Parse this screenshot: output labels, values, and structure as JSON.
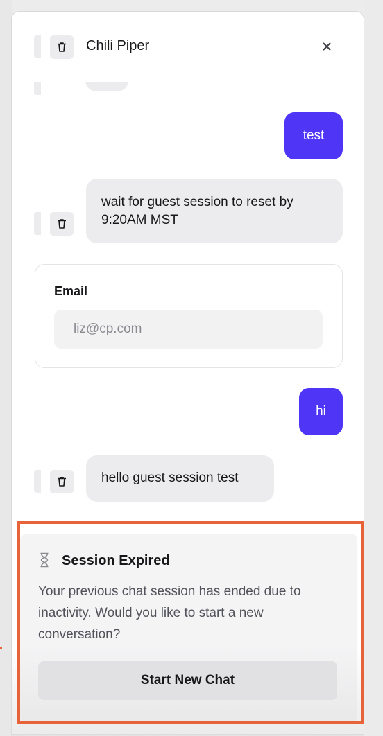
{
  "header": {
    "title": "Chili Piper",
    "close_label": "×"
  },
  "messages": [
    {
      "role": "user",
      "text": "test"
    },
    {
      "role": "bot",
      "text": "wait for guest session to reset by 9:20AM MST"
    },
    {
      "role": "user",
      "text": "hi"
    },
    {
      "role": "bot",
      "text": "hello guest session test"
    }
  ],
  "email_form": {
    "label": "Email",
    "value": "liz@cp.com"
  },
  "session_expired": {
    "title": "Session Expired",
    "message": "Your previous chat session has ended due to inactivity. Would you like to start a new conversation?",
    "button_label": "Start New Chat",
    "icon": "hourglass-icon"
  },
  "colors": {
    "accent": "#4f35f5",
    "highlight_outline": "#e8633a"
  }
}
